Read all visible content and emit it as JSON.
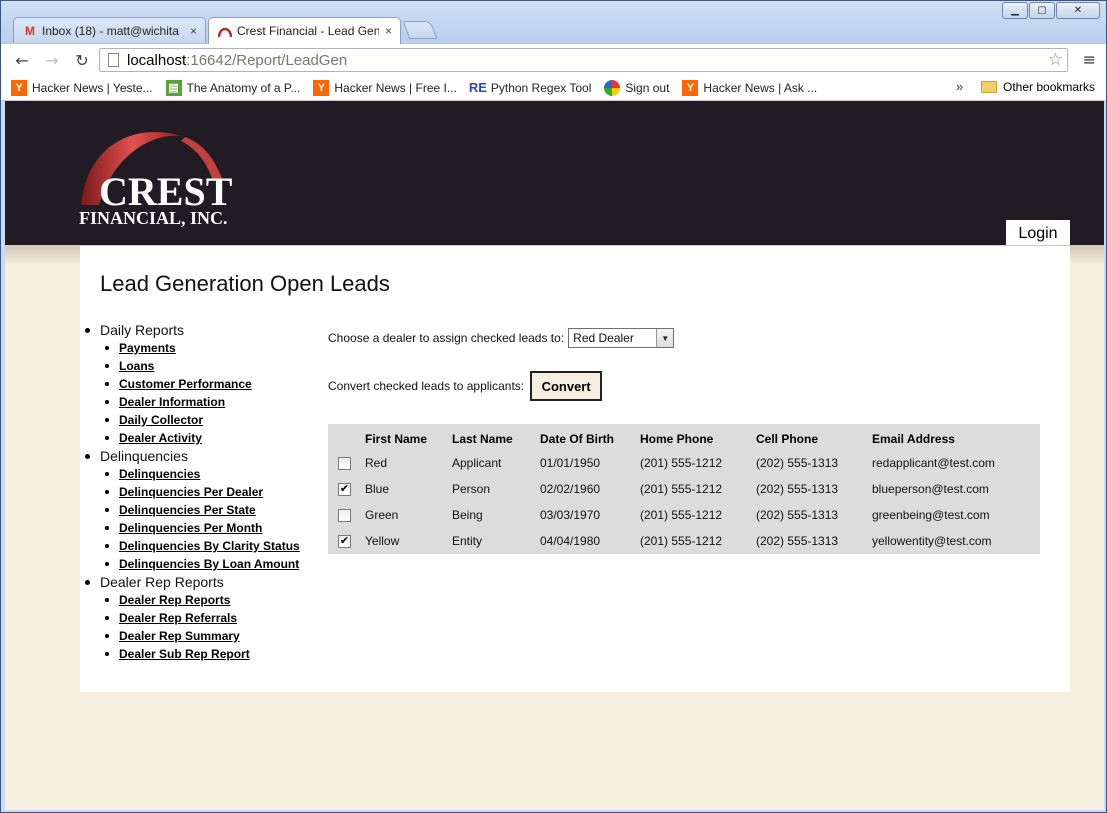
{
  "browser": {
    "tabs": [
      {
        "label": "Inbox (18) - matt@wichita",
        "favicon": "gmail-icon"
      },
      {
        "label": "Crest Financial - Lead Gen",
        "favicon": "crest-icon"
      }
    ],
    "close_glyph": "×",
    "url_host": "localhost",
    "url_path": ":16642/Report/LeadGen",
    "bookmarks": [
      {
        "label": "Hacker News | Yeste...",
        "icon": "Y"
      },
      {
        "label": "The Anatomy of a P...",
        "icon": ""
      },
      {
        "label": "Hacker News | Free I...",
        "icon": "Y"
      },
      {
        "label": "Python Regex Tool",
        "icon": "RE"
      },
      {
        "label": "Sign out",
        "icon": ""
      },
      {
        "label": "Hacker News | Ask ...",
        "icon": "Y"
      }
    ],
    "bookmarks_overflow": "»",
    "other_bookmarks": "Other bookmarks"
  },
  "site": {
    "logo_word": "CREST",
    "logo_sub": "FINANCIAL, INC.",
    "login_label": "Login"
  },
  "page": {
    "title": "Lead Generation Open Leads",
    "assign_label": "Choose a dealer to assign checked leads to:",
    "dealer_selected": "Red Dealer",
    "convert_label": "Convert checked leads to applicants:",
    "convert_button": "Convert"
  },
  "sidebar": {
    "groups": [
      {
        "label": "Daily Reports",
        "items": [
          "Payments",
          "Loans",
          "Customer Performance",
          "Dealer Information",
          "Daily Collector",
          "Dealer Activity"
        ]
      },
      {
        "label": "Delinquencies",
        "items": [
          "Delinquencies",
          "Delinquencies Per Dealer",
          "Delinquencies Per State",
          "Delinquencies Per Month",
          "Delinquencies By Clarity Status",
          "Delinquencies By Loan Amount"
        ]
      },
      {
        "label": "Dealer Rep Reports",
        "items": [
          "Dealer Rep Reports",
          "Dealer Rep Referrals",
          "Dealer Rep Summary",
          "Dealer Sub Rep Report"
        ]
      }
    ]
  },
  "leads": {
    "columns": [
      "First Name",
      "Last Name",
      "Date Of Birth",
      "Home Phone",
      "Cell Phone",
      "Email Address"
    ],
    "rows": [
      {
        "checked": false,
        "first": "Red",
        "last": "Applicant",
        "dob": "01/01/1950",
        "home": "(201) 555-1212",
        "cell": "(202) 555-1313",
        "email": "redapplicant@test.com"
      },
      {
        "checked": true,
        "first": "Blue",
        "last": "Person",
        "dob": "02/02/1960",
        "home": "(201) 555-1212",
        "cell": "(202) 555-1313",
        "email": "blueperson@test.com"
      },
      {
        "checked": false,
        "first": "Green",
        "last": "Being",
        "dob": "03/03/1970",
        "home": "(201) 555-1212",
        "cell": "(202) 555-1313",
        "email": "greenbeing@test.com"
      },
      {
        "checked": true,
        "first": "Yellow",
        "last": "Entity",
        "dob": "04/04/1980",
        "home": "(201) 555-1212",
        "cell": "(202) 555-1313",
        "email": "yellowentity@test.com"
      }
    ]
  }
}
